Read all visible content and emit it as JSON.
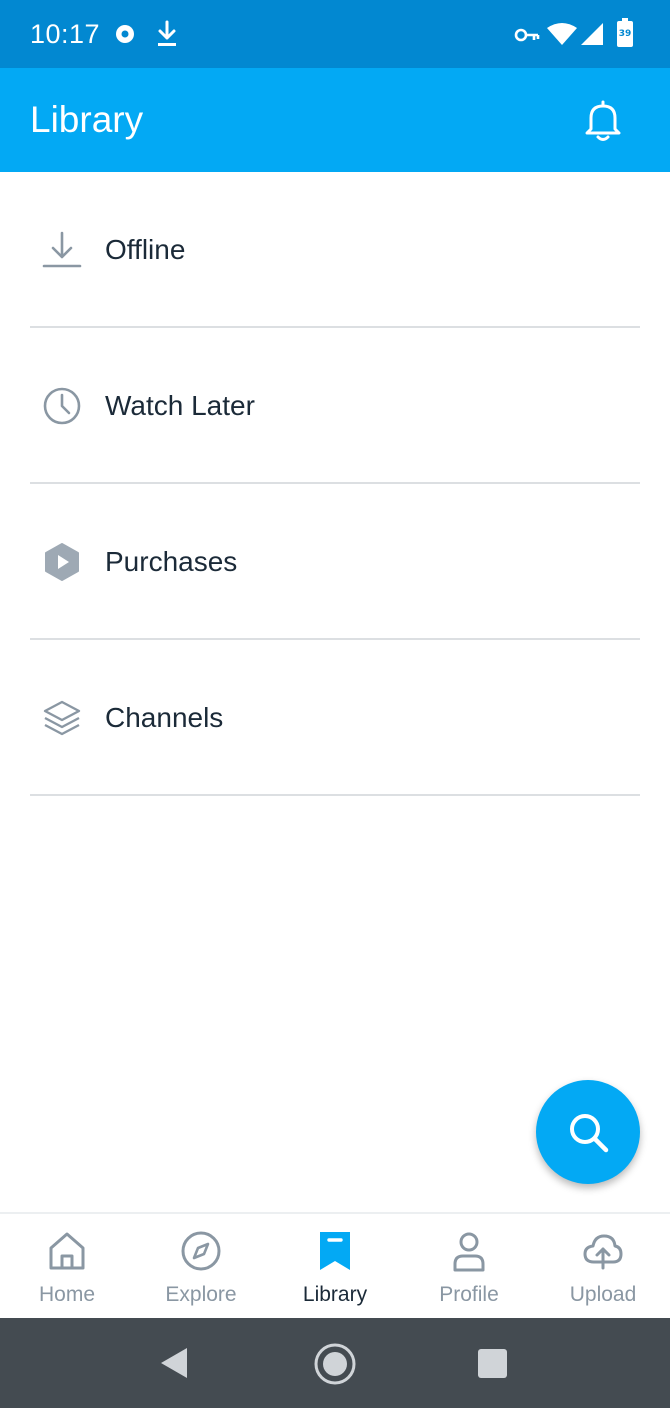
{
  "status_bar": {
    "time": "10:17",
    "battery_level": "39",
    "icons": [
      "circle-dot-icon",
      "download-icon",
      "vpn-key-icon",
      "wifi-icon",
      "cell-signal-icon",
      "battery-icon"
    ]
  },
  "app_bar": {
    "title": "Library",
    "action_icon": "bell-icon"
  },
  "menu": {
    "items": [
      {
        "label": "Offline",
        "icon": "download-icon"
      },
      {
        "label": "Watch Later",
        "icon": "clock-icon"
      },
      {
        "label": "Purchases",
        "icon": "play-hexagon-icon"
      },
      {
        "label": "Channels",
        "icon": "layers-icon"
      }
    ]
  },
  "fab": {
    "icon": "search-icon"
  },
  "bottom_nav": {
    "selected": "Library",
    "items": [
      {
        "label": "Home",
        "icon": "home-icon"
      },
      {
        "label": "Explore",
        "icon": "compass-icon"
      },
      {
        "label": "Library",
        "icon": "bookmark-icon"
      },
      {
        "label": "Profile",
        "icon": "person-icon"
      },
      {
        "label": "Upload",
        "icon": "cloud-upload-icon"
      }
    ]
  },
  "system_nav": {
    "icons": [
      "back-icon",
      "home-circle-icon",
      "recents-icon"
    ]
  },
  "colors": {
    "status_bar": "#0288d1",
    "primary": "#03a9f4",
    "text_dark": "#1b2a38",
    "icon_gray": "#8a97a3",
    "divider": "#dcdfe2",
    "system_nav": "#444b51"
  }
}
